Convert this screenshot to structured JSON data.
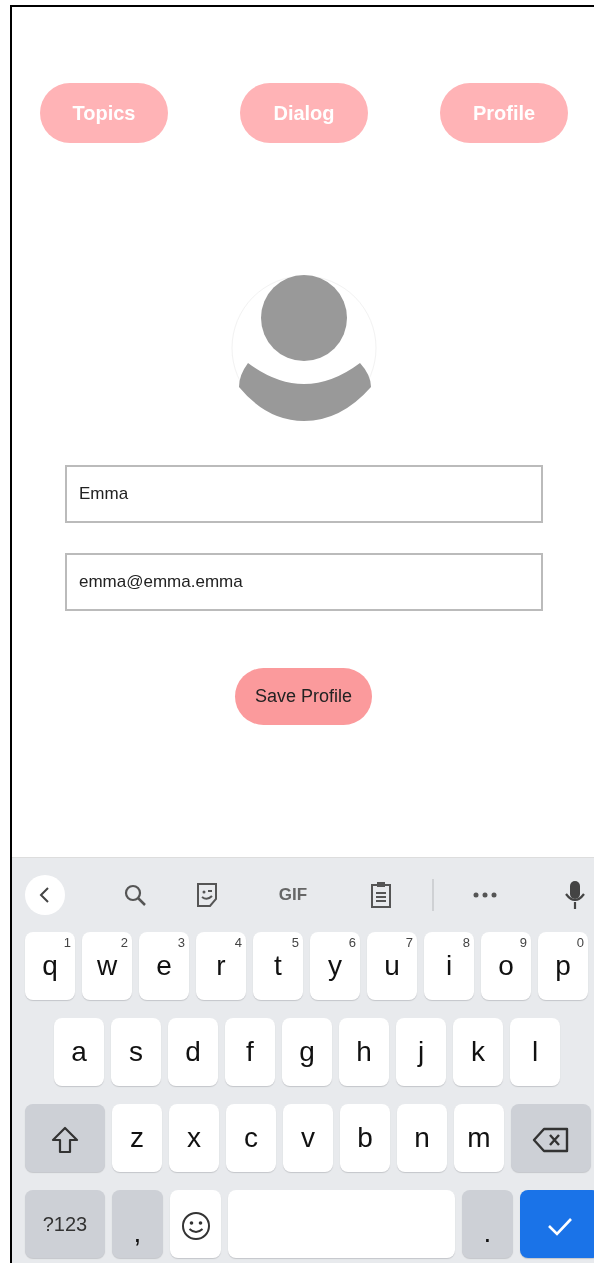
{
  "nav_buttons": [
    {
      "label": "Topics"
    },
    {
      "label": "Dialog"
    },
    {
      "label": "Profile"
    }
  ],
  "profile": {
    "fields": [
      {
        "value": "Emma"
      },
      {
        "value": "emma@emma.emma"
      }
    ],
    "save_button": "Save Profile"
  },
  "keyboard": {
    "toolbar": [
      {
        "kind": "back"
      },
      {
        "kind": "search"
      },
      {
        "kind": "sticker"
      },
      {
        "kind": "gif",
        "label": "GIF"
      },
      {
        "kind": "clipboard"
      },
      {
        "kind": "divider"
      },
      {
        "kind": "more"
      },
      {
        "kind": "mic"
      }
    ],
    "rows": [
      [
        {
          "kind": "letter",
          "label": "q",
          "hint": "1"
        },
        {
          "kind": "letter",
          "label": "w",
          "hint": "2"
        },
        {
          "kind": "letter",
          "label": "e",
          "hint": "3"
        },
        {
          "kind": "letter",
          "label": "r",
          "hint": "4"
        },
        {
          "kind": "letter",
          "label": "t",
          "hint": "5"
        },
        {
          "kind": "letter",
          "label": "y",
          "hint": "6"
        },
        {
          "kind": "letter",
          "label": "u",
          "hint": "7"
        },
        {
          "kind": "letter",
          "label": "i",
          "hint": "8"
        },
        {
          "kind": "letter",
          "label": "o",
          "hint": "9"
        },
        {
          "kind": "letter",
          "label": "p",
          "hint": "0"
        }
      ],
      [
        {
          "kind": "letter",
          "label": "a"
        },
        {
          "kind": "letter",
          "label": "s"
        },
        {
          "kind": "letter",
          "label": "d"
        },
        {
          "kind": "letter",
          "label": "f"
        },
        {
          "kind": "letter",
          "label": "g"
        },
        {
          "kind": "letter",
          "label": "h"
        },
        {
          "kind": "letter",
          "label": "j"
        },
        {
          "kind": "letter",
          "label": "k"
        },
        {
          "kind": "letter",
          "label": "l"
        }
      ],
      [
        {
          "kind": "shift"
        },
        {
          "kind": "letter",
          "label": "z"
        },
        {
          "kind": "letter",
          "label": "x"
        },
        {
          "kind": "letter",
          "label": "c"
        },
        {
          "kind": "letter",
          "label": "v"
        },
        {
          "kind": "letter",
          "label": "b"
        },
        {
          "kind": "letter",
          "label": "n"
        },
        {
          "kind": "letter",
          "label": "m"
        },
        {
          "kind": "backspace"
        }
      ],
      [
        {
          "kind": "symbols",
          "label": "?123"
        },
        {
          "kind": "punct",
          "label": ","
        },
        {
          "kind": "emoji"
        },
        {
          "kind": "space"
        },
        {
          "kind": "punct",
          "label": "."
        },
        {
          "kind": "enter"
        }
      ]
    ]
  }
}
